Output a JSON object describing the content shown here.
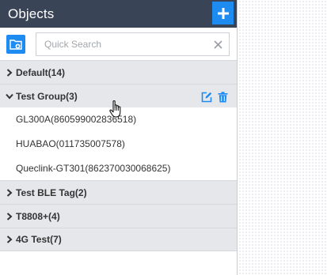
{
  "header": {
    "title": "Objects"
  },
  "search": {
    "placeholder": "Quick Search",
    "value": ""
  },
  "groups": [
    {
      "label": "Default(14)",
      "expanded": false
    },
    {
      "label": "Test Group(3)",
      "expanded": true,
      "items": [
        {
          "label": "GL300A(860599002836518)"
        },
        {
          "label": "HUABAO(011735007578)"
        },
        {
          "label": "Queclink-GT301(862370030068625)"
        }
      ]
    },
    {
      "label": "Test BLE Tag(2)",
      "expanded": false
    },
    {
      "label": "T8808+(4)",
      "expanded": false
    },
    {
      "label": "4G Test(7)",
      "expanded": false
    }
  ],
  "colors": {
    "header_bg": "#3a4457",
    "accent": "#1e8bf0",
    "group_bg": "#e5e7eb"
  },
  "icons": {
    "add": "plus-icon",
    "folder": "folder-add-icon",
    "clear": "close-icon",
    "collapsed": "chevron-right-icon",
    "expanded": "chevron-down-icon",
    "edit": "edit-icon",
    "delete": "trash-icon",
    "cursor": "hand-pointer-icon"
  }
}
